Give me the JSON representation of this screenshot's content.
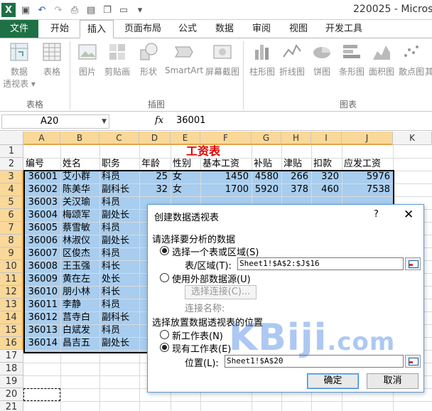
{
  "titlebar": {
    "title": "220025 - Microsof"
  },
  "tabs": [
    {
      "label": "文件"
    },
    {
      "label": "开始"
    },
    {
      "label": "插入"
    },
    {
      "label": "页面布局"
    },
    {
      "label": "公式"
    },
    {
      "label": "数据"
    },
    {
      "label": "审阅"
    },
    {
      "label": "视图"
    },
    {
      "label": "开发工具"
    }
  ],
  "ribbon": {
    "buttons": [
      "数据",
      "透视表",
      "表格",
      "图片",
      "剪贴画",
      "形状",
      "SmartArt",
      "屏幕截图",
      "柱形图",
      "折线图",
      "饼图",
      "条形图",
      "面积图",
      "散点图",
      "其"
    ],
    "groups": [
      "表格",
      "插图",
      "图表"
    ]
  },
  "formula_bar": {
    "name_box": "A20",
    "fx": "fx",
    "value": "36001"
  },
  "columns": [
    "A",
    "B",
    "C",
    "D",
    "E",
    "F",
    "G",
    "H",
    "I",
    "J",
    "K"
  ],
  "rows": [
    "1",
    "2",
    "3",
    "4",
    "5",
    "6",
    "7",
    "8",
    "9",
    "10",
    "11",
    "12",
    "13",
    "14",
    "15",
    "16",
    "17",
    "18",
    "19",
    "20",
    "21"
  ],
  "sheet": {
    "title": "工资表",
    "headers": [
      "编号",
      "姓名",
      "职务",
      "年龄",
      "性别",
      "基本工资",
      "补贴",
      "津贴",
      "扣款",
      "应发工资"
    ],
    "data_rows": [
      [
        "36001",
        "艾小群",
        "科员",
        "25",
        "女",
        "1450",
        "4580",
        "266",
        "320",
        "5976"
      ],
      [
        "36002",
        "陈美华",
        "副科长",
        "32",
        "女",
        "1700",
        "5920",
        "378",
        "460",
        "7538"
      ],
      [
        "36003",
        "关汉瑜",
        "科员",
        "",
        "",
        "",
        "",
        "",
        "",
        ""
      ],
      [
        "36004",
        "梅颂军",
        "副处长",
        "",
        "",
        "",
        "",
        "",
        "",
        ""
      ],
      [
        "36005",
        "蔡雪敏",
        "科员",
        "",
        "",
        "",
        "",
        "",
        "",
        ""
      ],
      [
        "36006",
        "林淑仪",
        "副处长",
        "",
        "",
        "",
        "",
        "",
        "",
        ""
      ],
      [
        "36007",
        "区俊杰",
        "科员",
        "",
        "",
        "",
        "",
        "",
        "",
        ""
      ],
      [
        "36008",
        "王玉强",
        "科长",
        "",
        "",
        "",
        "",
        "",
        "",
        ""
      ],
      [
        "36009",
        "黄在左",
        "处长",
        "",
        "",
        "",
        "",
        "",
        "",
        ""
      ],
      [
        "36010",
        "朋小林",
        "科长",
        "",
        "",
        "",
        "",
        "",
        "",
        ""
      ],
      [
        "36011",
        "李静",
        "科员",
        "",
        "",
        "",
        "",
        "",
        "",
        ""
      ],
      [
        "36012",
        "莒寺白",
        "副科长",
        "",
        "",
        "",
        "",
        "",
        "",
        ""
      ],
      [
        "36013",
        "白斌发",
        "科员",
        "",
        "",
        "",
        "",
        "",
        "",
        ""
      ],
      [
        "36014",
        "昌吉五",
        "副处长",
        "",
        "",
        "",
        "",
        "",
        "",
        ""
      ]
    ]
  },
  "dialog": {
    "title": "创建数据透视表",
    "help": "?",
    "close": "✕",
    "section1": "请选择要分析的数据",
    "opt_table_range": "选择一个表或区域(S)",
    "table_range_label": "表/区域(T):",
    "table_range_value": "Sheet1!$A$2:$J$16",
    "opt_external": "使用外部数据源(U)",
    "choose_connection": "选择连接(C)...",
    "connection_name_label": "连接名称:",
    "section2": "选择放置数据透视表的位置",
    "opt_new_sheet": "新工作表(N)",
    "opt_existing_sheet": "现有工作表(E)",
    "location_label": "位置(L):",
    "location_value": "Sheet1!$A$20",
    "ok": "确定",
    "cancel": "取消"
  },
  "watermark": {
    "main": "KBiji",
    "suffix": ".com"
  },
  "colors": {
    "excel_green": "#1e7145",
    "selection_blue": "#a8cdee",
    "title_red": "#e00000",
    "header_highlight": "#f9d899"
  }
}
